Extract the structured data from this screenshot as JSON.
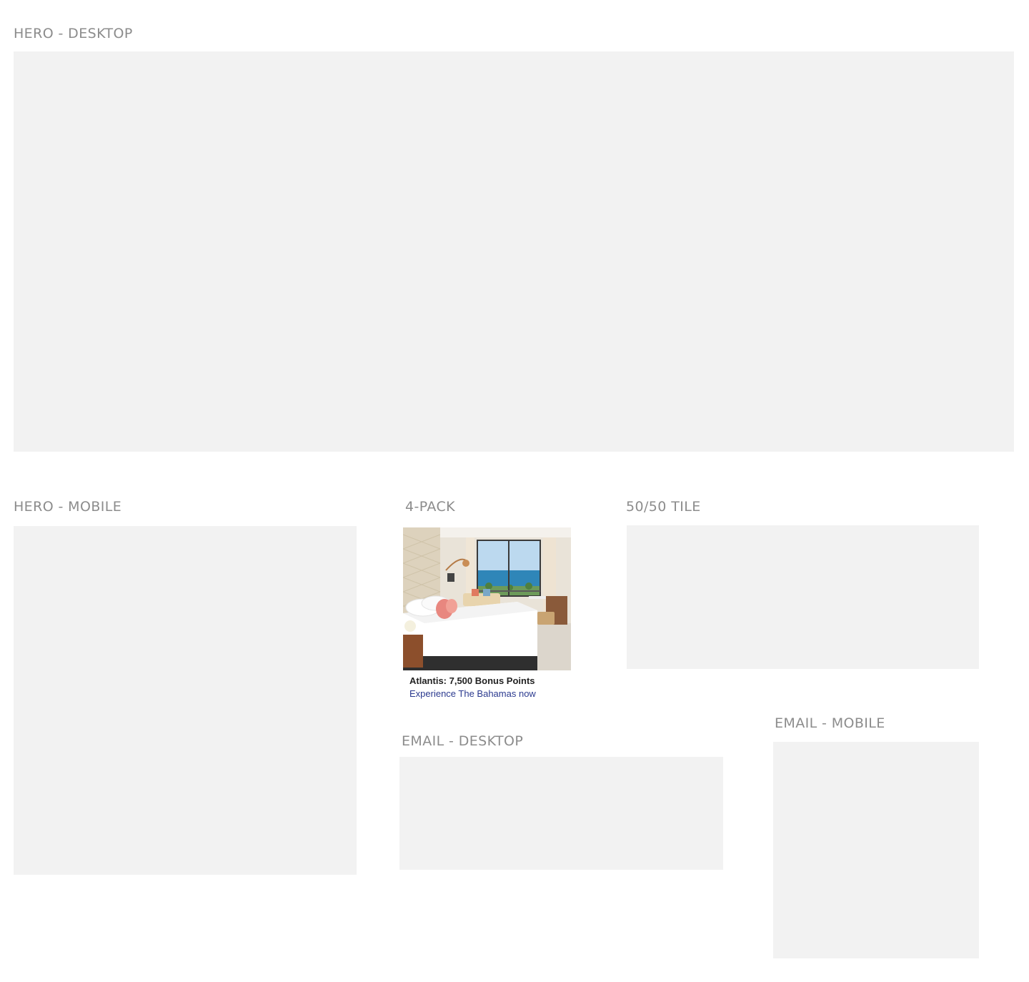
{
  "sections": {
    "hero_desktop": {
      "label": "HERO - DESKTOP"
    },
    "hero_mobile": {
      "label": "HERO - MOBILE"
    },
    "four_pack": {
      "label": "4-PACK",
      "card": {
        "title": "Atlantis: 7,500 Bonus Points",
        "subtitle": "Experience The Bahamas now"
      }
    },
    "fifty_tile": {
      "label": "50/50 TILE"
    },
    "email_desktop": {
      "label": "EMAIL - DESKTOP"
    },
    "email_mobile": {
      "label": "EMAIL - MOBILE"
    }
  },
  "colors": {
    "placeholder": "#f2f2f2",
    "label": "#8c8c8c",
    "link": "#2b3a8f"
  }
}
